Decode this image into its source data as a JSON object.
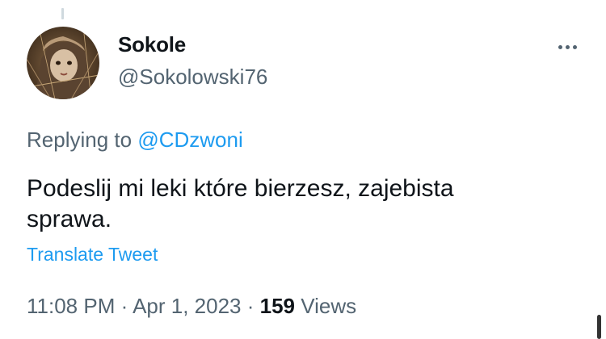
{
  "tweet": {
    "display_name": "Sokole",
    "handle": "@Sokolowski76",
    "replying_prefix": "Replying to",
    "replying_to": "@CDzwoni",
    "text": "Podeslij mi leki które bierzesz, zajebista sprawa.",
    "translate_label": "Translate Tweet",
    "time": "11:08 PM",
    "date": "Apr 1, 2023",
    "separator": "·",
    "views_count": "159",
    "views_label": "Views"
  },
  "icons": {
    "more": "more-horizontal-icon",
    "avatar": "doll-portrait-avatar"
  },
  "colors": {
    "link": "#1d9bf0",
    "secondary_text": "#536471",
    "primary_text": "#0f1419",
    "background": "#ffffff"
  }
}
